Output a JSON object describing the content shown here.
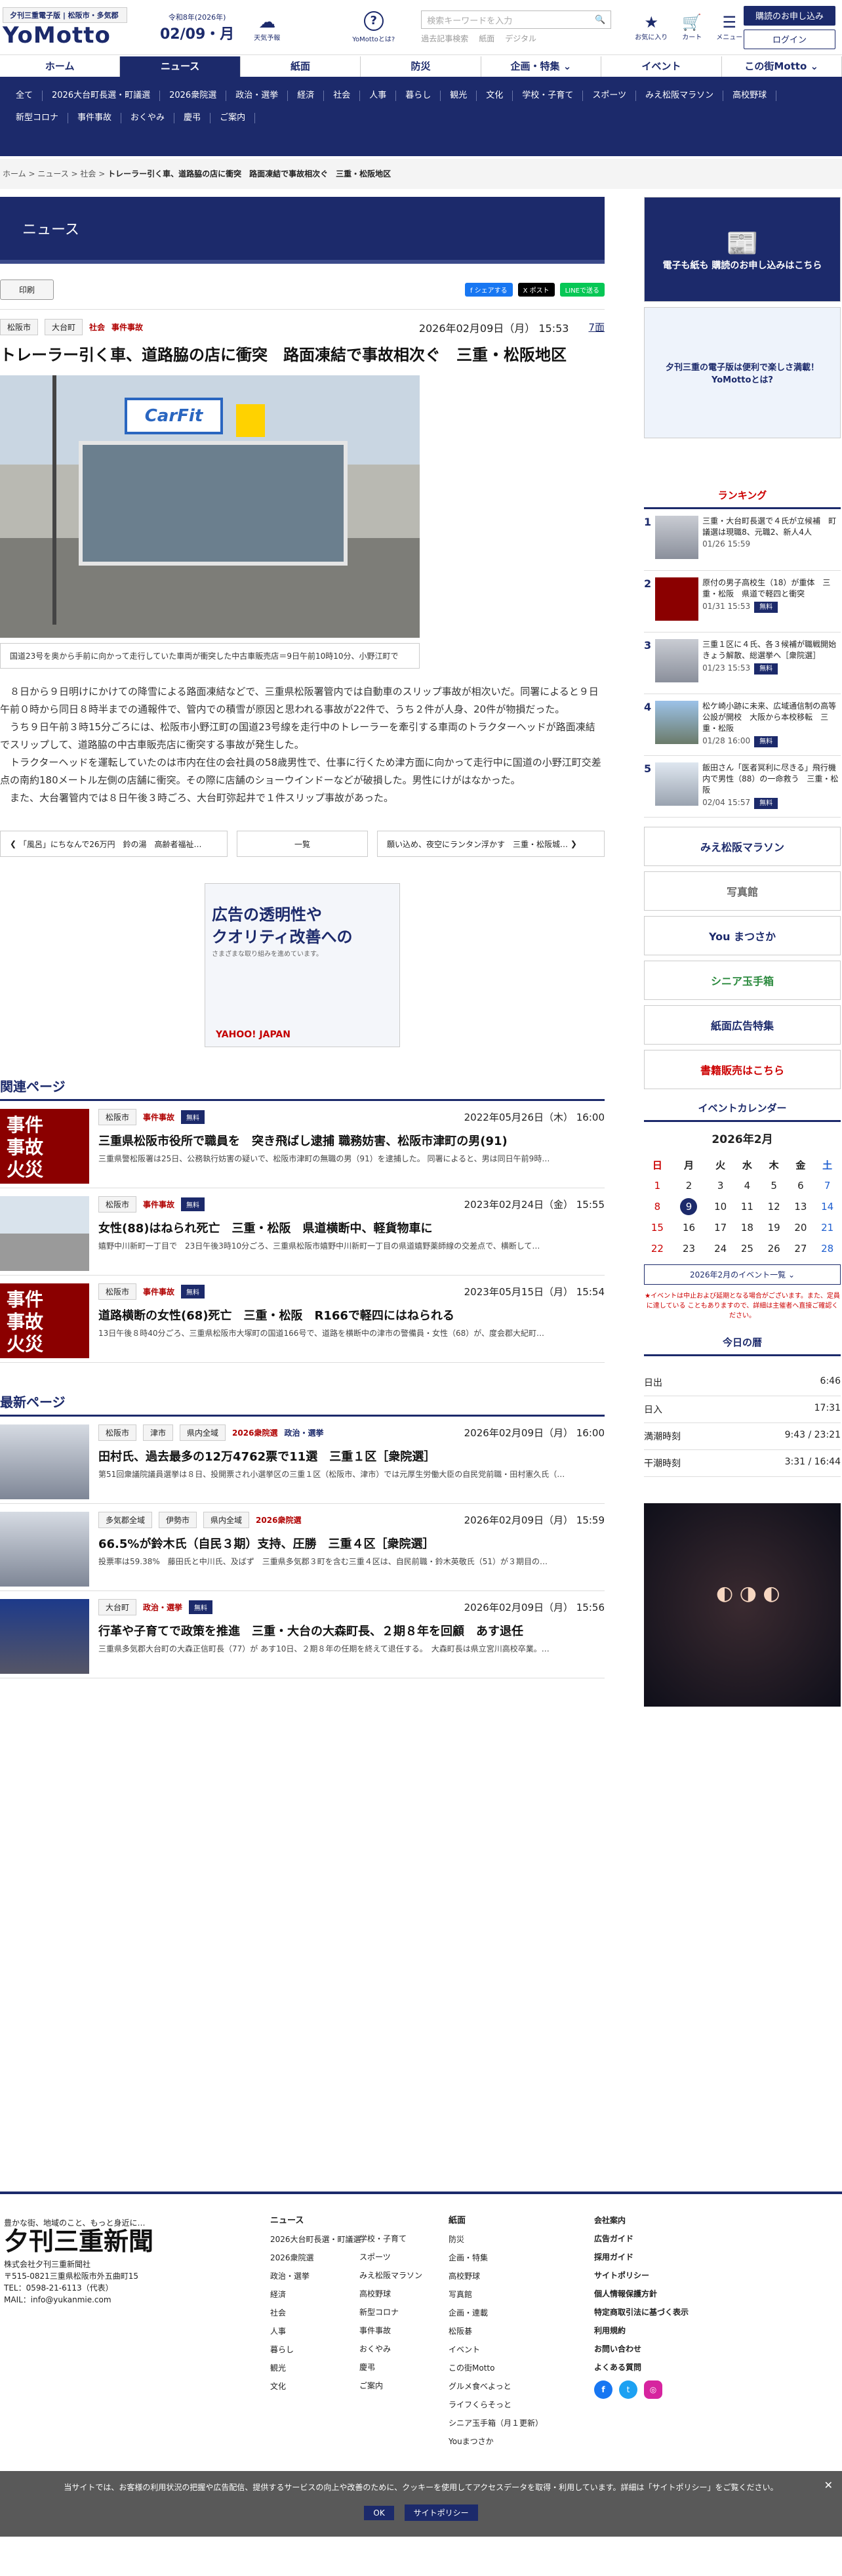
{
  "header": {
    "tagline": "夕刊三重電子版 | 松阪市・多気郡",
    "logo": "YoMotto",
    "era": "令和8年(2026年)",
    "date": "02/09・月",
    "weather_label": "天気予報",
    "about_label": "YoMottoとは?",
    "search_placeholder": "検索キーワードを入力",
    "search_links": [
      "過去記事検索",
      "紙面",
      "デジタル"
    ],
    "icon_labels": [
      "お気に入り",
      "カート",
      "メニュー"
    ],
    "subscribe_button": "購読のお申し込み",
    "login_button": "ログイン"
  },
  "nav": {
    "items": [
      "ホーム",
      "ニュース",
      "紙面",
      "防災",
      "企画・特集 ⌄",
      "イベント",
      "この街Motto ⌄"
    ],
    "active": "ニュース",
    "sub": [
      "全て",
      "2026大台町長選・町議選",
      "2026衆院選",
      "政治・選挙",
      "経済",
      "社会",
      "人事",
      "暮らし",
      "観光",
      "文化",
      "学校・子育て",
      "スポーツ",
      "みえ松阪マラソン",
      "高校野球",
      "新型コロナ",
      "事件事故",
      "おくやみ",
      "慶弔",
      "ご案内"
    ]
  },
  "breadcrumb": [
    "ホーム",
    "ニュース",
    "社会",
    "トレーラー引く車、道路脇の店に衝突　路面凍結で事故相次ぐ　三重・松阪地区"
  ],
  "section_title": "ニュース",
  "tools": {
    "print": "印刷",
    "share": [
      "f シェアする",
      "X ポスト",
      "LINEで送る"
    ]
  },
  "article": {
    "tags": [
      "松阪市",
      "大台町"
    ],
    "category": "社会",
    "subcategory": "事件事故",
    "date": "2026年02月09日（月） 15:53",
    "page": "7面",
    "title": "トレーラー引く車、道路脇の店に衝突　路面凍結で事故相次ぐ　三重・松阪地区",
    "photo_sign": "CarFit",
    "caption": "国道23号を奥から手前に向かって走行していた車両が衝突した中古車販売店＝9日午前10時10分、小野江町で",
    "paragraphs": [
      "８日から９日明けにかけての降雪による路面凍結などで、三重県松阪署管内では自動車のスリップ事故が相次いだ。同署によると９日午前０時から同日８時半までの通報件で、管内での積雪が原因と思われる事故が22件で、うち２件が人身、20件が物損だった。",
      "うち９日午前３時15分ごろには、松阪市小野江町の国道23号線を走行中のトレーラーを牽引する車両のトラクターヘッドが路面凍結でスリップして、道路脇の中古車販売店に衝突する事故が発生した。",
      "トラクターヘッドを運転していたのは市内在住の会社員の58歳男性で、仕事に行くため津方面に向かって走行中に国道の小野江町交差点の南約180メートル左側の店舗に衝突。その際に店舗のショーウインドーなどが破損した。男性にけがはなかった。",
      "また、大台署管内では８日午後３時ごろ、大台町弥起井で１件スリップ事故があった。"
    ]
  },
  "pager": {
    "prev": "「風呂」にちなんで26万円　鈴の湯　高齢者福祉…",
    "list": "一覧",
    "next": "願い込め、夜空にランタン浮かす　三重・松阪城…"
  },
  "ad": {
    "line1": "広告の透明性や",
    "line2": "クオリティ改善への",
    "line3": "さまざまな取り組みを進めています。",
    "brand": "YAHOO! JAPAN"
  },
  "related": {
    "heading": "関連ページ",
    "items": [
      {
        "tags": [
          "松阪市"
        ],
        "cat": "事件事故",
        "badge": "無料",
        "date": "2022年05月26日（木） 16:00",
        "title": "三重県松阪市役所で職員を　突き飛ばし逮捕 職務妨害、松阪市津町の男(91)",
        "summary": "三重県警松阪署は25日、公務執行妨害の疑いで、松阪市津町の無職の男（91）を逮捕した。 同署によると、男は同日午前9時…",
        "thumb": "jiko"
      },
      {
        "tags": [
          "松阪市"
        ],
        "cat": "事件事故",
        "badge": "無料",
        "date": "2023年02月24日（金） 15:55",
        "title": "女性(88)はねられ死亡　三重・松阪　県道横断中、軽貨物車に",
        "summary": "嬉野中川新町一丁目で　23日午後3時10分ごろ、三重県松阪市嬉野中川新町一丁目の県道嬉野薬師線の交差点で、横断して…",
        "thumb": "road"
      },
      {
        "tags": [
          "松阪市"
        ],
        "cat": "事件事故",
        "badge": "無料",
        "date": "2023年05月15日（月） 15:54",
        "title": "道路横断の女性(68)死亡　三重・松阪　R166で軽四にはねられる",
        "summary": "13日午後８時40分ごろ、三重県松阪市大塚町の国道166号で、道路を横断中の津市の警備員・女性（68）が、度会郡大紀町…",
        "thumb": "jiko"
      }
    ]
  },
  "latest": {
    "heading": "最新ページ",
    "items": [
      {
        "tags": [
          "松阪市",
          "津市",
          "県内全域"
        ],
        "cat": "2026衆院選",
        "cat2": "政治・選挙",
        "date": "2026年02月09日（月） 16:00",
        "title": "田村氏、過去最多の12万4762票で11選　三重１区［衆院選］",
        "summary": "第51回衆議院議員選挙は８日、投開票され小選挙区の三重１区（松阪市、津市）では元厚生労働大臣の自民党前職・田村憲久氏（…",
        "thumb": "ppl"
      },
      {
        "tags": [
          "多気郡全域",
          "伊勢市",
          "県内全域"
        ],
        "cat": "2026衆院選",
        "cat2": "",
        "date": "2026年02月09日（月） 15:59",
        "title": "66.5%が鈴木氏（自民３期）支持、圧勝　三重４区［衆院選］",
        "summary": "投票率は59.38%　藤田氏と中川氏、及ばず　三重県多気郡３町を含む三重４区は、自民前職・鈴木英敬氏（51）が３期目の…",
        "thumb": "ppl"
      },
      {
        "tags": [
          "大台町"
        ],
        "cat": "政治・選挙",
        "badge": "無料",
        "date": "2026年02月09日（月） 15:56",
        "title": "行革や子育てで政策を推進　三重・大台の大森町長、２期８年を回顧　あす退任",
        "summary": "三重県多気郡大台町の大森正信町長（77）が あす10日、２期８年の任期を終えて退任する。　大森町長は県立宮川高校卒業。…",
        "thumb": "man"
      }
    ]
  },
  "sidebar": {
    "banner1": "電子も紙も 購読のお申し込みはこちら",
    "banner2": "夕刊三重の電子版は便利で楽しさ満載！ YoMottoとは?",
    "ranking_title": "ランキング",
    "ranking": [
      {
        "rank": "1",
        "title": "三重・大台町長選で４氏が立候補　町議選は現職8、元職2、新人4人",
        "date": "01/26 15:59",
        "badge": ""
      },
      {
        "rank": "2",
        "title": "原付の男子高校生（18）が重体　三重・松阪　県道で軽四と衝突",
        "date": "01/31 15:53",
        "badge": "無料"
      },
      {
        "rank": "3",
        "title": "三重１区に４氏、各３候補が職戦開始　きょう解散、総選挙へ［衆院選］",
        "date": "01/23 15:53",
        "badge": "無料"
      },
      {
        "rank": "4",
        "title": "松ケ崎小跡に未来、広域通信制の高等公設が開校　大阪から本校移転　三重・松阪",
        "date": "01/28 16:00",
        "badge": "無料"
      },
      {
        "rank": "5",
        "title": "飯田さん「医者冥利に尽きる」飛行機内で男性（88）の一命救う　三重・松阪",
        "date": "02/04 15:57",
        "badge": "無料"
      }
    ],
    "banners": [
      "みえ松阪マラソン",
      "写真館",
      "You まつさか",
      "シニア玉手箱",
      "紙面広告特集",
      "書籍販売はこちら"
    ],
    "calendar_title": "イベントカレンダー",
    "month": "2026年2月",
    "weekdays": [
      "日",
      "月",
      "火",
      "水",
      "木",
      "金",
      "土"
    ],
    "weeks": [
      [
        "1",
        "2",
        "3",
        "4",
        "5",
        "6",
        "7"
      ],
      [
        "8",
        "9",
        "10",
        "11",
        "12",
        "13",
        "14"
      ],
      [
        "15",
        "16",
        "17",
        "18",
        "19",
        "20",
        "21"
      ],
      [
        "22",
        "23",
        "24",
        "25",
        "26",
        "27",
        "28"
      ]
    ],
    "today": "9",
    "cal_button": "2026年2月のイベント一覧",
    "cal_note": "★イベントは中止および延期となる場合がございます。また、定員に達している こともありますので、詳細は主催者へ直接ご確認ください。",
    "today_title": "今日の暦",
    "koyomi": [
      {
        "label": "日出",
        "value": "6:46"
      },
      {
        "label": "日入",
        "value": "17:31"
      },
      {
        "label": "満潮時刻",
        "value": "9:43 / 23:21"
      },
      {
        "label": "干潮時刻",
        "value": "3:31 / 16:44"
      }
    ]
  },
  "footer": {
    "catch": "豊かな街、地域のこと、もっと身近に…",
    "logo": "夕刊三重新聞",
    "address": [
      "株式会社夕刊三重新聞社",
      "〒515-0821三重県松阪市外五曲町15",
      "TEL：0598-21-6113（代表）",
      "MAIL：info@yukanmie.com"
    ],
    "col1_title": "ニュース",
    "col1": [
      "2026大台町長選・町議選",
      "2026衆院選",
      "政治・選挙",
      "経済",
      "社会",
      "人事",
      "暮らし",
      "観光",
      "文化"
    ],
    "col2": [
      "学校・子育て",
      "スポーツ",
      "みえ松阪マラソン",
      "高校野球",
      "新型コロナ",
      "事件事故",
      "おくやみ",
      "慶弔",
      "ご案内"
    ],
    "col3_title": "紙面",
    "col3": [
      "防災",
      "企画・特集",
      "高校野球",
      "写真館",
      "企画・連載",
      "松阪碁",
      "イベント",
      "この街Motto",
      "グルメ食べよっと",
      "ライフくらそっと",
      "シニア玉手箱（月１更新）",
      "Youまつさか"
    ],
    "col4": [
      "会社案内",
      "広告ガイド",
      "採用ガイド",
      "サイトポリシー",
      "個人情報保護方針",
      "特定商取引法に基づく表示",
      "利用規約",
      "お問い合わせ",
      "よくある質問"
    ]
  },
  "cookie": {
    "text": "当サイトでは、お客様の利用状況の把握や広告配信、提供するサービスの向上や改善のために、クッキーを使用してアクセスデータを取得・利用しています。詳細は「サイトポリシー」をご覧ください。",
    "ok": "OK",
    "policy": "サイトポリシー"
  }
}
